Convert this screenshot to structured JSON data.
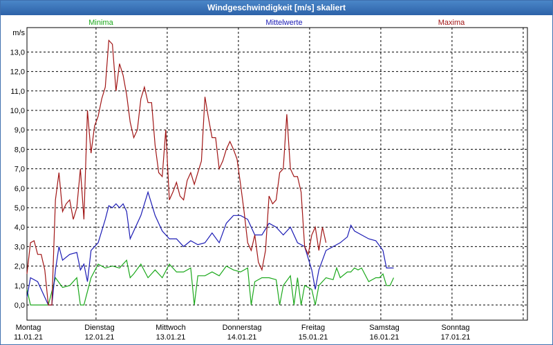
{
  "window": {
    "title": "Windgeschwindigkeit [m/s] skaliert"
  },
  "chart_data": {
    "type": "line",
    "title": "Windgeschwindigkeit [m/s] skaliert",
    "ylabel": "m/s",
    "ylim": [
      0,
      14
    ],
    "xlim": [
      0,
      7
    ],
    "grid": true,
    "yticks": [
      "0,0",
      "1,0",
      "2,0",
      "3,0",
      "4,0",
      "5,0",
      "6,0",
      "7,0",
      "8,0",
      "9,0",
      "10,0",
      "11,0",
      "12,0",
      "13,0"
    ],
    "day_labels": [
      {
        "day": "Montag",
        "date": "11.01.21"
      },
      {
        "day": "Dienstag",
        "date": "12.01.21"
      },
      {
        "day": "Mittwoch",
        "date": "13.01.21"
      },
      {
        "day": "Donnerstag",
        "date": "14.01.21"
      },
      {
        "day": "Freitag",
        "date": "15.01.21"
      },
      {
        "day": "Samstag",
        "date": "16.01.21"
      },
      {
        "day": "Sonntag",
        "date": "17.01.21"
      }
    ],
    "series": [
      {
        "name": "Minima",
        "color": "#1aa81a",
        "points": [
          [
            0,
            0.8
          ],
          [
            0.05,
            0
          ],
          [
            0.3,
            0
          ],
          [
            0.4,
            1.4
          ],
          [
            0.5,
            0.9
          ],
          [
            0.6,
            1.0
          ],
          [
            0.7,
            1.4
          ],
          [
            0.75,
            0
          ],
          [
            0.8,
            0
          ],
          [
            0.9,
            1.4
          ],
          [
            1.0,
            2.1
          ],
          [
            1.1,
            1.9
          ],
          [
            1.2,
            2.0
          ],
          [
            1.3,
            1.9
          ],
          [
            1.4,
            2.3
          ],
          [
            1.45,
            1.4
          ],
          [
            1.5,
            1.6
          ],
          [
            1.6,
            2.1
          ],
          [
            1.7,
            1.4
          ],
          [
            1.8,
            1.8
          ],
          [
            1.9,
            1.4
          ],
          [
            2.0,
            2.1
          ],
          [
            2.1,
            1.7
          ],
          [
            2.2,
            1.7
          ],
          [
            2.3,
            1.9
          ],
          [
            2.35,
            0
          ],
          [
            2.4,
            1.5
          ],
          [
            2.5,
            1.5
          ],
          [
            2.6,
            1.7
          ],
          [
            2.7,
            1.5
          ],
          [
            2.8,
            2.0
          ],
          [
            2.9,
            1.8
          ],
          [
            3.0,
            1.7
          ],
          [
            3.1,
            1.9
          ],
          [
            3.15,
            0
          ],
          [
            3.2,
            1.2
          ],
          [
            3.3,
            1.4
          ],
          [
            3.4,
            1.4
          ],
          [
            3.5,
            1.3
          ],
          [
            3.55,
            0
          ],
          [
            3.6,
            1.0
          ],
          [
            3.7,
            1.5
          ],
          [
            3.75,
            0
          ],
          [
            3.8,
            1.4
          ],
          [
            3.85,
            0
          ],
          [
            3.9,
            1.0
          ],
          [
            4.0,
            0.8
          ],
          [
            4.05,
            0
          ],
          [
            4.1,
            1.0
          ],
          [
            4.2,
            1.4
          ],
          [
            4.3,
            1.3
          ],
          [
            4.35,
            1.9
          ],
          [
            4.4,
            1.4
          ],
          [
            4.5,
            1.7
          ],
          [
            4.55,
            1.7
          ],
          [
            4.6,
            1.9
          ],
          [
            4.65,
            1.8
          ],
          [
            4.7,
            1.9
          ],
          [
            4.8,
            1.2
          ],
          [
            4.9,
            1.4
          ],
          [
            4.95,
            1.4
          ],
          [
            5.0,
            1.6
          ],
          [
            5.05,
            1.0
          ],
          [
            5.1,
            1.0
          ],
          [
            5.15,
            1.4
          ]
        ]
      },
      {
        "name": "Mittelwerte",
        "color": "#1a1ab4",
        "points": [
          [
            0,
            0.4
          ],
          [
            0.05,
            1.4
          ],
          [
            0.15,
            1.2
          ],
          [
            0.2,
            0.8
          ],
          [
            0.3,
            0
          ],
          [
            0.35,
            0
          ],
          [
            0.4,
            1.8
          ],
          [
            0.45,
            3.0
          ],
          [
            0.5,
            2.3
          ],
          [
            0.6,
            2.6
          ],
          [
            0.7,
            2.7
          ],
          [
            0.75,
            1.8
          ],
          [
            0.8,
            2.1
          ],
          [
            0.85,
            1.2
          ],
          [
            0.9,
            2.8
          ],
          [
            1.0,
            3.2
          ],
          [
            1.1,
            4.4
          ],
          [
            1.15,
            5.1
          ],
          [
            1.2,
            5.0
          ],
          [
            1.25,
            5.2
          ],
          [
            1.3,
            5.0
          ],
          [
            1.35,
            5.2
          ],
          [
            1.4,
            4.8
          ],
          [
            1.45,
            3.4
          ],
          [
            1.5,
            3.8
          ],
          [
            1.6,
            4.6
          ],
          [
            1.65,
            5.2
          ],
          [
            1.7,
            5.8
          ],
          [
            1.8,
            4.6
          ],
          [
            1.9,
            3.8
          ],
          [
            2.0,
            3.4
          ],
          [
            2.1,
            3.4
          ],
          [
            2.2,
            3.0
          ],
          [
            2.3,
            3.3
          ],
          [
            2.4,
            3.1
          ],
          [
            2.5,
            3.2
          ],
          [
            2.6,
            3.7
          ],
          [
            2.7,
            3.2
          ],
          [
            2.8,
            4.2
          ],
          [
            2.9,
            4.6
          ],
          [
            3.0,
            4.6
          ],
          [
            3.1,
            4.4
          ],
          [
            3.2,
            3.6
          ],
          [
            3.3,
            3.6
          ],
          [
            3.4,
            4.2
          ],
          [
            3.5,
            4.0
          ],
          [
            3.6,
            3.6
          ],
          [
            3.7,
            4.0
          ],
          [
            3.8,
            3.2
          ],
          [
            3.9,
            3.0
          ],
          [
            4.0,
            1.8
          ],
          [
            4.05,
            0.8
          ],
          [
            4.1,
            1.8
          ],
          [
            4.2,
            2.8
          ],
          [
            4.3,
            3.0
          ],
          [
            4.4,
            3.2
          ],
          [
            4.5,
            3.5
          ],
          [
            4.55,
            4.1
          ],
          [
            4.6,
            3.8
          ],
          [
            4.7,
            3.6
          ],
          [
            4.8,
            3.4
          ],
          [
            4.9,
            3.3
          ],
          [
            5.0,
            2.8
          ],
          [
            5.05,
            1.9
          ],
          [
            5.15,
            1.9
          ]
        ]
      },
      {
        "name": "Maxima",
        "color": "#a01414",
        "points": [
          [
            0,
            1.6
          ],
          [
            0.05,
            3.2
          ],
          [
            0.1,
            3.3
          ],
          [
            0.15,
            2.6
          ],
          [
            0.2,
            2.6
          ],
          [
            0.25,
            1.8
          ],
          [
            0.3,
            0
          ],
          [
            0.35,
            0
          ],
          [
            0.4,
            5.4
          ],
          [
            0.45,
            6.8
          ],
          [
            0.5,
            4.8
          ],
          [
            0.55,
            5.2
          ],
          [
            0.6,
            5.4
          ],
          [
            0.65,
            4.4
          ],
          [
            0.7,
            5.0
          ],
          [
            0.75,
            7.0
          ],
          [
            0.8,
            4.4
          ],
          [
            0.85,
            10.0
          ],
          [
            0.9,
            7.8
          ],
          [
            0.95,
            9.2
          ],
          [
            1.0,
            9.7
          ],
          [
            1.05,
            10.6
          ],
          [
            1.1,
            11.2
          ],
          [
            1.15,
            13.6
          ],
          [
            1.2,
            13.4
          ],
          [
            1.25,
            11.0
          ],
          [
            1.3,
            12.4
          ],
          [
            1.35,
            11.8
          ],
          [
            1.4,
            10.8
          ],
          [
            1.45,
            9.4
          ],
          [
            1.5,
            8.6
          ],
          [
            1.55,
            9.0
          ],
          [
            1.6,
            10.6
          ],
          [
            1.65,
            11.2
          ],
          [
            1.7,
            10.4
          ],
          [
            1.75,
            10.4
          ],
          [
            1.8,
            8.2
          ],
          [
            1.85,
            6.8
          ],
          [
            1.9,
            6.6
          ],
          [
            1.95,
            9.0
          ],
          [
            2.0,
            5.4
          ],
          [
            2.05,
            5.8
          ],
          [
            2.1,
            6.3
          ],
          [
            2.15,
            5.6
          ],
          [
            2.2,
            5.4
          ],
          [
            2.25,
            6.4
          ],
          [
            2.3,
            6.8
          ],
          [
            2.35,
            6.2
          ],
          [
            2.4,
            6.8
          ],
          [
            2.45,
            7.4
          ],
          [
            2.5,
            10.7
          ],
          [
            2.55,
            9.6
          ],
          [
            2.6,
            8.6
          ],
          [
            2.65,
            8.6
          ],
          [
            2.7,
            7.0
          ],
          [
            2.75,
            7.4
          ],
          [
            2.8,
            8.0
          ],
          [
            2.85,
            8.4
          ],
          [
            2.9,
            8.0
          ],
          [
            2.95,
            7.5
          ],
          [
            3.0,
            6.2
          ],
          [
            3.05,
            4.8
          ],
          [
            3.1,
            3.2
          ],
          [
            3.15,
            2.8
          ],
          [
            3.2,
            3.6
          ],
          [
            3.25,
            2.2
          ],
          [
            3.3,
            1.8
          ],
          [
            3.35,
            2.8
          ],
          [
            3.4,
            5.6
          ],
          [
            3.45,
            5.2
          ],
          [
            3.5,
            5.4
          ],
          [
            3.55,
            6.8
          ],
          [
            3.6,
            7.0
          ],
          [
            3.65,
            9.8
          ],
          [
            3.7,
            7.0
          ],
          [
            3.75,
            6.6
          ],
          [
            3.8,
            6.6
          ],
          [
            3.85,
            5.8
          ],
          [
            3.9,
            3.0
          ],
          [
            3.95,
            2.6
          ],
          [
            4.0,
            3.6
          ],
          [
            4.05,
            4.0
          ],
          [
            4.1,
            2.8
          ],
          [
            4.15,
            4.0
          ],
          [
            4.2,
            3.2
          ]
        ]
      }
    ]
  }
}
